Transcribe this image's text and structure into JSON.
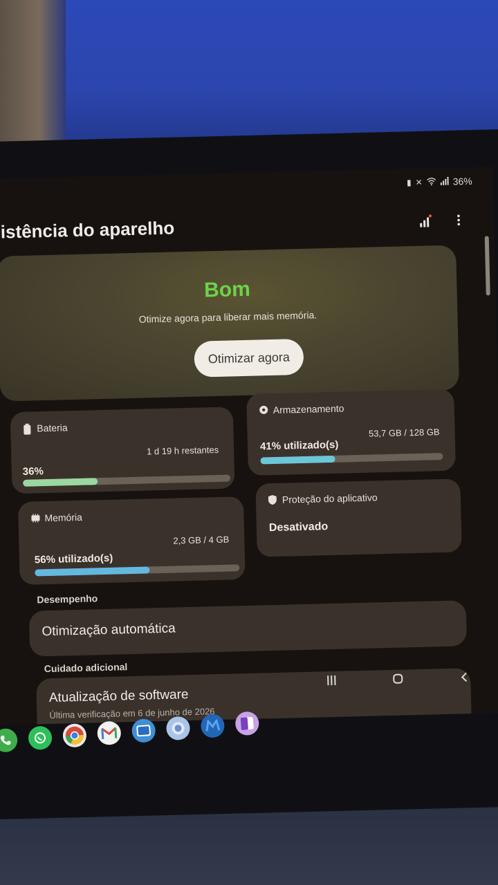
{
  "status_bar": {
    "battery_percent": "36%",
    "icons": [
      "battery-saver-icon",
      "mute-icon",
      "wifi-icon",
      "signal-icon"
    ]
  },
  "header": {
    "title": "sistência do aparelho",
    "icons": [
      "diagnostics-icon",
      "more-options-icon"
    ]
  },
  "hero": {
    "status": "Bom",
    "message": "Otimize agora para liberar mais memória.",
    "button_label": "Otimizar agora"
  },
  "tiles": {
    "battery": {
      "label": "Bateria",
      "value": "36%",
      "sub": "1 d 19 h restantes",
      "fill": 0.36,
      "color": "#9bd8a0"
    },
    "storage": {
      "label": "Armazenamento",
      "value": "41% utilizado(s)",
      "sub": "53,7 GB / 128 GB",
      "fill": 0.41,
      "color": "#6bc6d8"
    },
    "memory": {
      "label": "Memória",
      "value": "56% utilizado(s)",
      "sub": "2,3 GB / 4 GB",
      "fill": 0.56,
      "color": "#64b8e0"
    },
    "app_protection": {
      "label": "Proteção do aplicativo",
      "value": "Desativado"
    }
  },
  "sections": {
    "performance": {
      "label": "Desempenho",
      "items": [
        {
          "title": "Otimização automática"
        }
      ]
    },
    "extra_care": {
      "label": "Cuidado adicional",
      "items": [
        {
          "title": "Atualização de software",
          "subtitle": "Última verificação em 6 de junho de 2026"
        }
      ]
    }
  },
  "nav": [
    "recents-icon",
    "home-icon",
    "back-icon"
  ],
  "dock": [
    {
      "name": "phone-app-icon",
      "color": "#3fae4a"
    },
    {
      "name": "whatsapp-icon",
      "color": "#2fbf59"
    },
    {
      "name": "chrome-icon",
      "color": "#e8e8e8"
    },
    {
      "name": "gmail-icon",
      "color": "#f2f2f2"
    },
    {
      "name": "gallery-icon",
      "color": "#3e8fd6"
    },
    {
      "name": "messages-icon",
      "color": "#a9c4e8"
    },
    {
      "name": "malwarebytes-icon",
      "color": "#2266b8"
    },
    {
      "name": "onenote-icon",
      "color": "#c7a2e8"
    }
  ]
}
